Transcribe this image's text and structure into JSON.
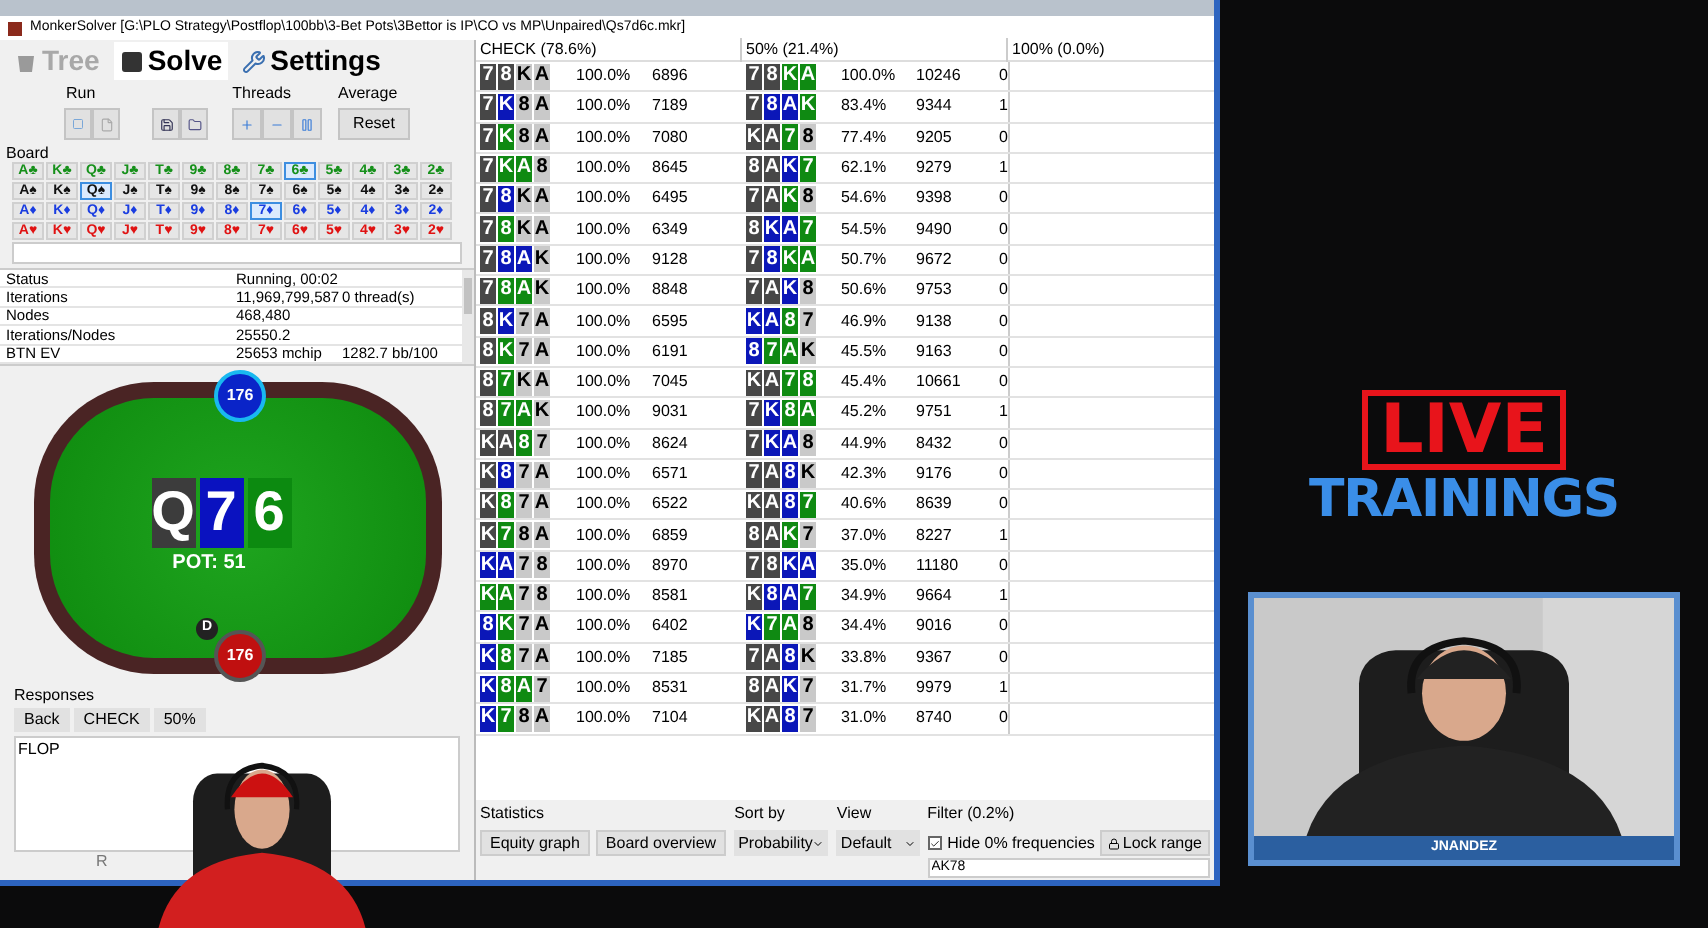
{
  "window": {
    "title": "MonkerSolver [G:\\PLO Strategy\\Postflop\\100bb\\3-Bet Pots\\3Bettor is IP\\CO vs MP\\Unpaired\\Qs7d6c.mkr]"
  },
  "tabs": [
    {
      "label": "Tree",
      "selected": false,
      "disabled": true
    },
    {
      "label": "Solve",
      "selected": true,
      "disabled": false
    },
    {
      "label": "Settings",
      "selected": false,
      "disabled": false
    }
  ],
  "groups": {
    "run": "Run",
    "threads": "Threads",
    "average": "Average",
    "reset": "Reset"
  },
  "board": {
    "label": "Board",
    "suits": [
      {
        "symbol": "♣",
        "color": "#16901a",
        "cards": [
          {
            "rank": "A",
            "selected": false
          },
          {
            "rank": "K",
            "selected": false
          },
          {
            "rank": "Q",
            "selected": false
          },
          {
            "rank": "J",
            "selected": false
          },
          {
            "rank": "T",
            "selected": false
          },
          {
            "rank": "9",
            "selected": false
          },
          {
            "rank": "8",
            "selected": false
          },
          {
            "rank": "7",
            "selected": false
          },
          {
            "rank": "6",
            "selected": true
          },
          {
            "rank": "5",
            "selected": false
          },
          {
            "rank": "4",
            "selected": false
          },
          {
            "rank": "3",
            "selected": false
          },
          {
            "rank": "2",
            "selected": false
          }
        ]
      },
      {
        "symbol": "♠",
        "color": "#111111",
        "cards": [
          {
            "rank": "A",
            "selected": false
          },
          {
            "rank": "K",
            "selected": false
          },
          {
            "rank": "Q",
            "selected": true
          },
          {
            "rank": "J",
            "selected": false
          },
          {
            "rank": "T",
            "selected": false
          },
          {
            "rank": "9",
            "selected": false
          },
          {
            "rank": "8",
            "selected": false
          },
          {
            "rank": "7",
            "selected": false
          },
          {
            "rank": "6",
            "selected": false
          },
          {
            "rank": "5",
            "selected": false
          },
          {
            "rank": "4",
            "selected": false
          },
          {
            "rank": "3",
            "selected": false
          },
          {
            "rank": "2",
            "selected": false
          }
        ]
      },
      {
        "symbol": "♦",
        "color": "#1a3de0",
        "cards": [
          {
            "rank": "A",
            "selected": false
          },
          {
            "rank": "K",
            "selected": false
          },
          {
            "rank": "Q",
            "selected": false
          },
          {
            "rank": "J",
            "selected": false
          },
          {
            "rank": "T",
            "selected": false
          },
          {
            "rank": "9",
            "selected": false
          },
          {
            "rank": "8",
            "selected": false
          },
          {
            "rank": "7",
            "selected": true
          },
          {
            "rank": "6",
            "selected": false
          },
          {
            "rank": "5",
            "selected": false
          },
          {
            "rank": "4",
            "selected": false
          },
          {
            "rank": "3",
            "selected": false
          },
          {
            "rank": "2",
            "selected": false
          }
        ]
      },
      {
        "symbol": "♥",
        "color": "#e01212",
        "cards": [
          {
            "rank": "A",
            "selected": false
          },
          {
            "rank": "K",
            "selected": false
          },
          {
            "rank": "Q",
            "selected": false
          },
          {
            "rank": "J",
            "selected": false
          },
          {
            "rank": "T",
            "selected": false
          },
          {
            "rank": "9",
            "selected": false
          },
          {
            "rank": "8",
            "selected": false
          },
          {
            "rank": "7",
            "selected": false
          },
          {
            "rank": "6",
            "selected": false
          },
          {
            "rank": "5",
            "selected": false
          },
          {
            "rank": "4",
            "selected": false
          },
          {
            "rank": "3",
            "selected": false
          },
          {
            "rank": "2",
            "selected": false
          }
        ]
      }
    ]
  },
  "stats": [
    {
      "label": "Status",
      "value": "Running, 00:02"
    },
    {
      "label": "Iterations",
      "value": "11,969,799,587",
      "extra": "0 thread(s)"
    },
    {
      "label": "Nodes",
      "value": "468,480"
    },
    {
      "label": "Iterations/Nodes",
      "value": "25550.2"
    },
    {
      "label": "BTN EV",
      "value": "25653 mchip",
      "extra": "1282.7 bb/100"
    }
  ],
  "poker_table": {
    "top_seat": "176",
    "bottom_seat": "176",
    "dealer": "D",
    "pot": "POT: 51",
    "cards": [
      {
        "rank": "Q",
        "color": "#3c3c3c"
      },
      {
        "rank": "7",
        "color": "#0a12c0"
      },
      {
        "rank": "6",
        "color": "#0c8a10"
      }
    ]
  },
  "responses": {
    "label": "Responses",
    "buttons": [
      "Back",
      "CHECK",
      "50%"
    ],
    "log": "FLOP",
    "footer": "R"
  },
  "strategy": {
    "columns": [
      "CHECK (78.6%)",
      "50% (21.4%)",
      "100% (0.0%)"
    ],
    "rows": [
      {
        "check": {
          "cards": [
            {
              "rank": "7",
              "color": "#474747"
            },
            {
              "rank": "8",
              "color": "#474747"
            },
            {
              "rank": "K",
              "color": "#c9c9c9"
            },
            {
              "rank": "A",
              "color": "#c9c9c9"
            }
          ],
          "frequency": "100.0%",
          "ev": "6896"
        },
        "bet": {
          "cards": [
            {
              "rank": "7",
              "color": "#474747"
            },
            {
              "rank": "8",
              "color": "#474747"
            },
            {
              "rank": "K",
              "color": "#0f8a12"
            },
            {
              "rank": "A",
              "color": "#0f8a12"
            }
          ],
          "frequency": "100.0%",
          "ev": "10246",
          "column_3": "0"
        }
      },
      {
        "check": {
          "cards": [
            {
              "rank": "7",
              "color": "#474747"
            },
            {
              "rank": "K",
              "color": "#0b17b8"
            },
            {
              "rank": "8",
              "color": "#c9c9c9"
            },
            {
              "rank": "A",
              "color": "#c9c9c9"
            }
          ],
          "frequency": "100.0%",
          "ev": "7189"
        },
        "bet": {
          "cards": [
            {
              "rank": "7",
              "color": "#474747"
            },
            {
              "rank": "8",
              "color": "#0b17b8"
            },
            {
              "rank": "A",
              "color": "#0b17b8"
            },
            {
              "rank": "K",
              "color": "#0f8a12"
            }
          ],
          "frequency": "83.4%",
          "ev": "9344",
          "column_3": "1"
        }
      },
      {
        "check": {
          "cards": [
            {
              "rank": "7",
              "color": "#474747"
            },
            {
              "rank": "K",
              "color": "#0f8a12"
            },
            {
              "rank": "8",
              "color": "#c9c9c9"
            },
            {
              "rank": "A",
              "color": "#c9c9c9"
            }
          ],
          "frequency": "100.0%",
          "ev": "7080"
        },
        "bet": {
          "cards": [
            {
              "rank": "K",
              "color": "#474747"
            },
            {
              "rank": "A",
              "color": "#474747"
            },
            {
              "rank": "7",
              "color": "#0f8a12"
            },
            {
              "rank": "8",
              "color": "#c9c9c9"
            }
          ],
          "frequency": "77.4%",
          "ev": "9205",
          "column_3": "0"
        }
      },
      {
        "check": {
          "cards": [
            {
              "rank": "7",
              "color": "#474747"
            },
            {
              "rank": "K",
              "color": "#0f8a12"
            },
            {
              "rank": "A",
              "color": "#0f8a12"
            },
            {
              "rank": "8",
              "color": "#c9c9c9"
            }
          ],
          "frequency": "100.0%",
          "ev": "8645"
        },
        "bet": {
          "cards": [
            {
              "rank": "8",
              "color": "#474747"
            },
            {
              "rank": "A",
              "color": "#474747"
            },
            {
              "rank": "K",
              "color": "#0b17b8"
            },
            {
              "rank": "7",
              "color": "#0f8a12"
            }
          ],
          "frequency": "62.1%",
          "ev": "9279",
          "column_3": "1"
        }
      },
      {
        "check": {
          "cards": [
            {
              "rank": "7",
              "color": "#474747"
            },
            {
              "rank": "8",
              "color": "#0b17b8"
            },
            {
              "rank": "K",
              "color": "#c9c9c9"
            },
            {
              "rank": "A",
              "color": "#c9c9c9"
            }
          ],
          "frequency": "100.0%",
          "ev": "6495"
        },
        "bet": {
          "cards": [
            {
              "rank": "7",
              "color": "#474747"
            },
            {
              "rank": "A",
              "color": "#474747"
            },
            {
              "rank": "K",
              "color": "#0f8a12"
            },
            {
              "rank": "8",
              "color": "#c9c9c9"
            }
          ],
          "frequency": "54.6%",
          "ev": "9398",
          "column_3": "0"
        }
      },
      {
        "check": {
          "cards": [
            {
              "rank": "7",
              "color": "#474747"
            },
            {
              "rank": "8",
              "color": "#0f8a12"
            },
            {
              "rank": "K",
              "color": "#c9c9c9"
            },
            {
              "rank": "A",
              "color": "#c9c9c9"
            }
          ],
          "frequency": "100.0%",
          "ev": "6349"
        },
        "bet": {
          "cards": [
            {
              "rank": "8",
              "color": "#474747"
            },
            {
              "rank": "K",
              "color": "#0b17b8"
            },
            {
              "rank": "A",
              "color": "#0b17b8"
            },
            {
              "rank": "7",
              "color": "#0f8a12"
            }
          ],
          "frequency": "54.5%",
          "ev": "9490",
          "column_3": "0"
        }
      },
      {
        "check": {
          "cards": [
            {
              "rank": "7",
              "color": "#474747"
            },
            {
              "rank": "8",
              "color": "#0b17b8"
            },
            {
              "rank": "A",
              "color": "#0b17b8"
            },
            {
              "rank": "K",
              "color": "#c9c9c9"
            }
          ],
          "frequency": "100.0%",
          "ev": "9128"
        },
        "bet": {
          "cards": [
            {
              "rank": "7",
              "color": "#474747"
            },
            {
              "rank": "8",
              "color": "#0b17b8"
            },
            {
              "rank": "K",
              "color": "#0f8a12"
            },
            {
              "rank": "A",
              "color": "#0f8a12"
            }
          ],
          "frequency": "50.7%",
          "ev": "9672",
          "column_3": "0"
        }
      },
      {
        "check": {
          "cards": [
            {
              "rank": "7",
              "color": "#474747"
            },
            {
              "rank": "8",
              "color": "#0f8a12"
            },
            {
              "rank": "A",
              "color": "#0f8a12"
            },
            {
              "rank": "K",
              "color": "#c9c9c9"
            }
          ],
          "frequency": "100.0%",
          "ev": "8848"
        },
        "bet": {
          "cards": [
            {
              "rank": "7",
              "color": "#474747"
            },
            {
              "rank": "A",
              "color": "#474747"
            },
            {
              "rank": "K",
              "color": "#0b17b8"
            },
            {
              "rank": "8",
              "color": "#c9c9c9"
            }
          ],
          "frequency": "50.6%",
          "ev": "9753",
          "column_3": "0"
        }
      },
      {
        "check": {
          "cards": [
            {
              "rank": "8",
              "color": "#474747"
            },
            {
              "rank": "K",
              "color": "#0b17b8"
            },
            {
              "rank": "7",
              "color": "#c9c9c9"
            },
            {
              "rank": "A",
              "color": "#c9c9c9"
            }
          ],
          "frequency": "100.0%",
          "ev": "6595"
        },
        "bet": {
          "cards": [
            {
              "rank": "K",
              "color": "#0b17b8"
            },
            {
              "rank": "A",
              "color": "#0b17b8"
            },
            {
              "rank": "8",
              "color": "#0f8a12"
            },
            {
              "rank": "7",
              "color": "#c9c9c9"
            }
          ],
          "frequency": "46.9%",
          "ev": "9138",
          "column_3": "0"
        }
      },
      {
        "check": {
          "cards": [
            {
              "rank": "8",
              "color": "#474747"
            },
            {
              "rank": "K",
              "color": "#0f8a12"
            },
            {
              "rank": "7",
              "color": "#c9c9c9"
            },
            {
              "rank": "A",
              "color": "#c9c9c9"
            }
          ],
          "frequency": "100.0%",
          "ev": "6191"
        },
        "bet": {
          "cards": [
            {
              "rank": "8",
              "color": "#0b17b8"
            },
            {
              "rank": "7",
              "color": "#0f8a12"
            },
            {
              "rank": "A",
              "color": "#0f8a12"
            },
            {
              "rank": "K",
              "color": "#c9c9c9"
            }
          ],
          "frequency": "45.5%",
          "ev": "9163",
          "column_3": "0"
        }
      },
      {
        "check": {
          "cards": [
            {
              "rank": "8",
              "color": "#474747"
            },
            {
              "rank": "7",
              "color": "#0f8a12"
            },
            {
              "rank": "K",
              "color": "#c9c9c9"
            },
            {
              "rank": "A",
              "color": "#c9c9c9"
            }
          ],
          "frequency": "100.0%",
          "ev": "7045"
        },
        "bet": {
          "cards": [
            {
              "rank": "K",
              "color": "#474747"
            },
            {
              "rank": "A",
              "color": "#474747"
            },
            {
              "rank": "7",
              "color": "#0f8a12"
            },
            {
              "rank": "8",
              "color": "#0f8a12"
            }
          ],
          "frequency": "45.4%",
          "ev": "10661",
          "column_3": "0"
        }
      },
      {
        "check": {
          "cards": [
            {
              "rank": "8",
              "color": "#474747"
            },
            {
              "rank": "7",
              "color": "#0f8a12"
            },
            {
              "rank": "A",
              "color": "#0f8a12"
            },
            {
              "rank": "K",
              "color": "#c9c9c9"
            }
          ],
          "frequency": "100.0%",
          "ev": "9031"
        },
        "bet": {
          "cards": [
            {
              "rank": "7",
              "color": "#474747"
            },
            {
              "rank": "K",
              "color": "#0b17b8"
            },
            {
              "rank": "8",
              "color": "#0f8a12"
            },
            {
              "rank": "A",
              "color": "#0f8a12"
            }
          ],
          "frequency": "45.2%",
          "ev": "9751",
          "column_3": "1"
        }
      },
      {
        "check": {
          "cards": [
            {
              "rank": "K",
              "color": "#474747"
            },
            {
              "rank": "A",
              "color": "#474747"
            },
            {
              "rank": "8",
              "color": "#0f8a12"
            },
            {
              "rank": "7",
              "color": "#c9c9c9"
            }
          ],
          "frequency": "100.0%",
          "ev": "8624"
        },
        "bet": {
          "cards": [
            {
              "rank": "7",
              "color": "#474747"
            },
            {
              "rank": "K",
              "color": "#0b17b8"
            },
            {
              "rank": "A",
              "color": "#0b17b8"
            },
            {
              "rank": "8",
              "color": "#c9c9c9"
            }
          ],
          "frequency": "44.9%",
          "ev": "8432",
          "column_3": "0"
        }
      },
      {
        "check": {
          "cards": [
            {
              "rank": "K",
              "color": "#474747"
            },
            {
              "rank": "8",
              "color": "#0b17b8"
            },
            {
              "rank": "7",
              "color": "#c9c9c9"
            },
            {
              "rank": "A",
              "color": "#c9c9c9"
            }
          ],
          "frequency": "100.0%",
          "ev": "6571"
        },
        "bet": {
          "cards": [
            {
              "rank": "7",
              "color": "#474747"
            },
            {
              "rank": "A",
              "color": "#474747"
            },
            {
              "rank": "8",
              "color": "#0b17b8"
            },
            {
              "rank": "K",
              "color": "#c9c9c9"
            }
          ],
          "frequency": "42.3%",
          "ev": "9176",
          "column_3": "0"
        }
      },
      {
        "check": {
          "cards": [
            {
              "rank": "K",
              "color": "#474747"
            },
            {
              "rank": "8",
              "color": "#0f8a12"
            },
            {
              "rank": "7",
              "color": "#c9c9c9"
            },
            {
              "rank": "A",
              "color": "#c9c9c9"
            }
          ],
          "frequency": "100.0%",
          "ev": "6522"
        },
        "bet": {
          "cards": [
            {
              "rank": "K",
              "color": "#474747"
            },
            {
              "rank": "A",
              "color": "#474747"
            },
            {
              "rank": "8",
              "color": "#0b17b8"
            },
            {
              "rank": "7",
              "color": "#0f8a12"
            }
          ],
          "frequency": "40.6%",
          "ev": "8639",
          "column_3": "0"
        }
      },
      {
        "check": {
          "cards": [
            {
              "rank": "K",
              "color": "#474747"
            },
            {
              "rank": "7",
              "color": "#0f8a12"
            },
            {
              "rank": "8",
              "color": "#c9c9c9"
            },
            {
              "rank": "A",
              "color": "#c9c9c9"
            }
          ],
          "frequency": "100.0%",
          "ev": "6859"
        },
        "bet": {
          "cards": [
            {
              "rank": "8",
              "color": "#474747"
            },
            {
              "rank": "A",
              "color": "#474747"
            },
            {
              "rank": "K",
              "color": "#0f8a12"
            },
            {
              "rank": "7",
              "color": "#c9c9c9"
            }
          ],
          "frequency": "37.0%",
          "ev": "8227",
          "column_3": "1"
        }
      },
      {
        "check": {
          "cards": [
            {
              "rank": "K",
              "color": "#0b17b8"
            },
            {
              "rank": "A",
              "color": "#0b17b8"
            },
            {
              "rank": "7",
              "color": "#c9c9c9"
            },
            {
              "rank": "8",
              "color": "#c9c9c9"
            }
          ],
          "frequency": "100.0%",
          "ev": "8970"
        },
        "bet": {
          "cards": [
            {
              "rank": "7",
              "color": "#474747"
            },
            {
              "rank": "8",
              "color": "#474747"
            },
            {
              "rank": "K",
              "color": "#0b17b8"
            },
            {
              "rank": "A",
              "color": "#0b17b8"
            }
          ],
          "frequency": "35.0%",
          "ev": "11180",
          "column_3": "0"
        }
      },
      {
        "check": {
          "cards": [
            {
              "rank": "K",
              "color": "#0f8a12"
            },
            {
              "rank": "A",
              "color": "#0f8a12"
            },
            {
              "rank": "7",
              "color": "#c9c9c9"
            },
            {
              "rank": "8",
              "color": "#c9c9c9"
            }
          ],
          "frequency": "100.0%",
          "ev": "8581"
        },
        "bet": {
          "cards": [
            {
              "rank": "K",
              "color": "#474747"
            },
            {
              "rank": "8",
              "color": "#0b17b8"
            },
            {
              "rank": "A",
              "color": "#0b17b8"
            },
            {
              "rank": "7",
              "color": "#0f8a12"
            }
          ],
          "frequency": "34.9%",
          "ev": "9664",
          "column_3": "1"
        }
      },
      {
        "check": {
          "cards": [
            {
              "rank": "8",
              "color": "#0b17b8"
            },
            {
              "rank": "K",
              "color": "#0f8a12"
            },
            {
              "rank": "7",
              "color": "#c9c9c9"
            },
            {
              "rank": "A",
              "color": "#c9c9c9"
            }
          ],
          "frequency": "100.0%",
          "ev": "6402"
        },
        "bet": {
          "cards": [
            {
              "rank": "K",
              "color": "#0b17b8"
            },
            {
              "rank": "7",
              "color": "#0f8a12"
            },
            {
              "rank": "A",
              "color": "#0f8a12"
            },
            {
              "rank": "8",
              "color": "#c9c9c9"
            }
          ],
          "frequency": "34.4%",
          "ev": "9016",
          "column_3": "0"
        }
      },
      {
        "check": {
          "cards": [
            {
              "rank": "K",
              "color": "#0b17b8"
            },
            {
              "rank": "8",
              "color": "#0f8a12"
            },
            {
              "rank": "7",
              "color": "#c9c9c9"
            },
            {
              "rank": "A",
              "color": "#c9c9c9"
            }
          ],
          "frequency": "100.0%",
          "ev": "7185"
        },
        "bet": {
          "cards": [
            {
              "rank": "7",
              "color": "#474747"
            },
            {
              "rank": "A",
              "color": "#474747"
            },
            {
              "rank": "8",
              "color": "#0b17b8"
            },
            {
              "rank": "K",
              "color": "#c9c9c9"
            }
          ],
          "frequency": "33.8%",
          "ev": "9367",
          "column_3": "0"
        }
      },
      {
        "check": {
          "cards": [
            {
              "rank": "K",
              "color": "#0b17b8"
            },
            {
              "rank": "8",
              "color": "#0f8a12"
            },
            {
              "rank": "A",
              "color": "#0f8a12"
            },
            {
              "rank": "7",
              "color": "#c9c9c9"
            }
          ],
          "frequency": "100.0%",
          "ev": "8531"
        },
        "bet": {
          "cards": [
            {
              "rank": "8",
              "color": "#474747"
            },
            {
              "rank": "A",
              "color": "#474747"
            },
            {
              "rank": "K",
              "color": "#0b17b8"
            },
            {
              "rank": "7",
              "color": "#c9c9c9"
            }
          ],
          "frequency": "31.7%",
          "ev": "9979",
          "column_3": "1"
        }
      },
      {
        "check": {
          "cards": [
            {
              "rank": "K",
              "color": "#0b17b8"
            },
            {
              "rank": "7",
              "color": "#0f8a12"
            },
            {
              "rank": "8",
              "color": "#c9c9c9"
            },
            {
              "rank": "A",
              "color": "#c9c9c9"
            }
          ],
          "frequency": "100.0%",
          "ev": "7104"
        },
        "bet": {
          "cards": [
            {
              "rank": "K",
              "color": "#474747"
            },
            {
              "rank": "A",
              "color": "#474747"
            },
            {
              "rank": "8",
              "color": "#0b17b8"
            },
            {
              "rank": "7",
              "color": "#c9c9c9"
            }
          ],
          "frequency": "31.0%",
          "ev": "8740",
          "column_3": "0"
        }
      }
    ]
  },
  "controls": {
    "statistics": "Statistics",
    "equity_graph": "Equity graph",
    "board_overview": "Board overview",
    "sort_by": "Sort by",
    "sort_value": "Probability",
    "view": "View",
    "view_value": "Default",
    "filter": "Filter (0.2%)",
    "hide_zero": {
      "label": "Hide 0% frequencies",
      "checked": true
    },
    "lock_range": "Lock range",
    "filter_value": "AK78"
  },
  "overlay": {
    "live": "LIVE",
    "trainings": "TRAININGS",
    "caption": "JNANDEZ"
  }
}
